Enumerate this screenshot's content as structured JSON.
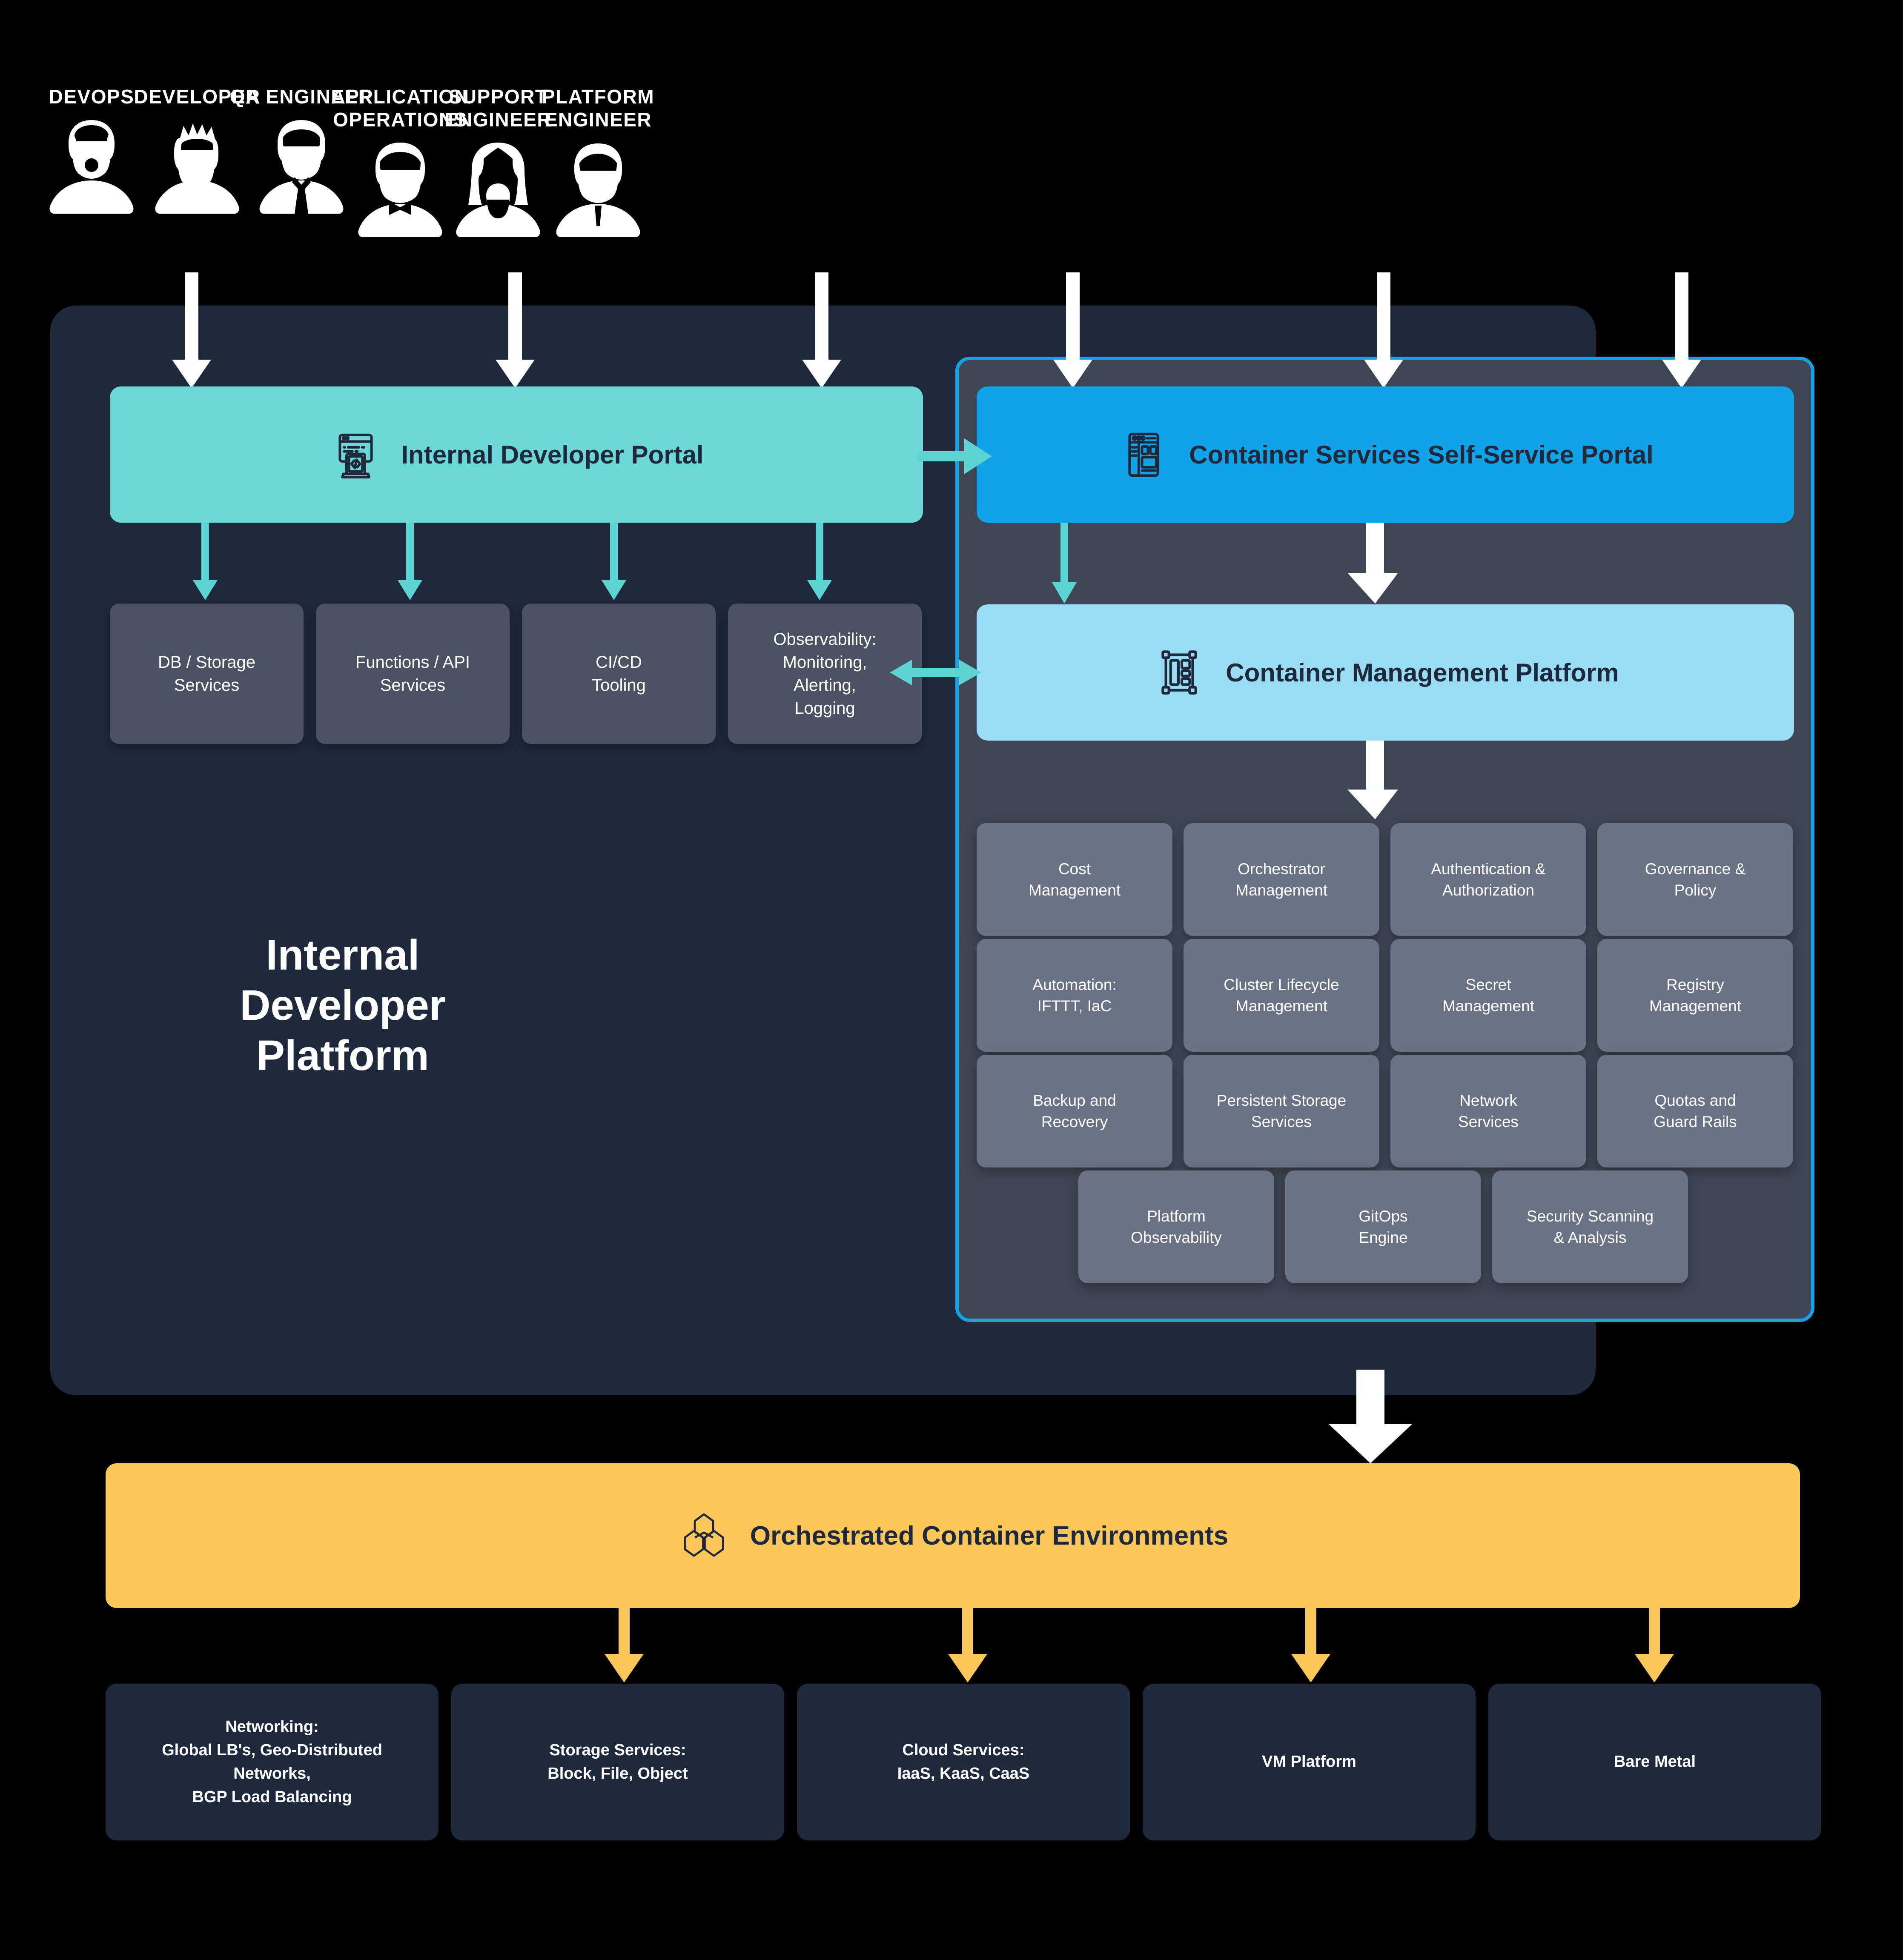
{
  "personas": [
    {
      "label": "DEVOPS",
      "avatar": "person-bearded-icon"
    },
    {
      "label": "DEVELOPER",
      "avatar": "person-spiky-hair-icon"
    },
    {
      "label": "QA ENGINEER",
      "avatar": "person-tie-icon"
    },
    {
      "label": "APPLICATION\nOPERATIONS",
      "avatar": "person-bowtie-icon"
    },
    {
      "label": "SUPPORT\nENGINEER",
      "avatar": "person-long-hair-icon"
    },
    {
      "label": "PLATFORM\nENGINEER",
      "avatar": "person-short-hair-icon"
    }
  ],
  "platform": {
    "title": "Internal\nDeveloper\nPlatform",
    "developer_portal": {
      "label": "Internal Developer Portal",
      "icon": "code-window-icon"
    },
    "services": [
      {
        "label": "DB / Storage\nServices"
      },
      {
        "label": "Functions / API\nServices"
      },
      {
        "label": "CI/CD\nTooling"
      },
      {
        "label": "Observability:\nMonitoring,\nAlerting,\nLogging"
      }
    ]
  },
  "container_services": {
    "self_service_portal": {
      "label": "Container Services Self-Service Portal",
      "icon": "dashboard-layout-icon"
    },
    "management_platform": {
      "label": "Container Management Platform",
      "icon": "container-rack-icon"
    },
    "capabilities": [
      {
        "label": "Cost\nManagement"
      },
      {
        "label": "Orchestrator\nManagement"
      },
      {
        "label": "Authentication &\nAuthorization"
      },
      {
        "label": "Governance &\nPolicy"
      },
      {
        "label": "Automation:\nIFTTT, IaC"
      },
      {
        "label": "Cluster Lifecycle\nManagement"
      },
      {
        "label": "Secret\nManagement"
      },
      {
        "label": "Registry\nManagement"
      },
      {
        "label": "Backup and\nRecovery"
      },
      {
        "label": "Persistent Storage\nServices"
      },
      {
        "label": "Network\nServices"
      },
      {
        "label": "Quotas and\nGuard Rails"
      },
      {
        "label": "Platform\nObservability"
      },
      {
        "label": "GitOps\nEngine"
      },
      {
        "label": "Security Scanning\n& Analysis"
      }
    ]
  },
  "orchestrated": {
    "label": "Orchestrated Container Environments",
    "icon": "cubes-stack-icon"
  },
  "infrastructure": [
    {
      "label": "Networking:\nGlobal LB's, Geo-Distributed\nNetworks,\nBGP Load Balancing"
    },
    {
      "label": "Storage Services:\nBlock, File, Object"
    },
    {
      "label": "Cloud Services:\nIaaS, KaaS, CaaS"
    },
    {
      "label": "VM Platform"
    },
    {
      "label": "Bare Metal"
    }
  ],
  "colors": {
    "background": "#000000",
    "panel": "#1E293B",
    "teal": "#6DD8D8",
    "teal_arrow": "#5CD4D4",
    "blue": "#11A2E8",
    "light_blue": "#9BDCF5",
    "amber": "#FBC75A",
    "card_gray": "#4B5261",
    "tile_gray": "#6A7384",
    "inner_panel": "#3E4654",
    "white": "#FFFFFF"
  }
}
